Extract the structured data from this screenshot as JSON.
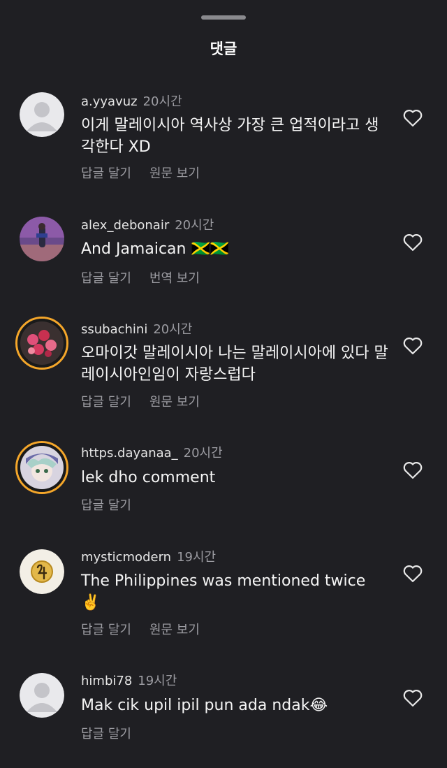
{
  "header": {
    "title": "댓글"
  },
  "comments": [
    {
      "user": "a.yyavuz",
      "time": "20시간",
      "text": "이게 말레이시아 역사상 가장 큰 업적이라고 생각한다 XD",
      "reply": "답글 달기",
      "extra": "원문 보기",
      "avatar": "default-avatar"
    },
    {
      "user": "alex_debonair",
      "time": "20시간",
      "text": "And Jamaican 🇯🇲🇯🇲",
      "reply": "답글 달기",
      "extra": "번역 보기",
      "avatar": "photo-avatar"
    },
    {
      "user": "ssubachini",
      "time": "20시간",
      "text": "오마이갓 말레이시아 나는 말레이시아에 있다 말레이시아인임이 자랑스럽다",
      "reply": "답글 달기",
      "extra": "원문 보기",
      "avatar": "roses-avatar"
    },
    {
      "user": "https.dayanaa_",
      "time": "20시간",
      "text": "lek dho comment",
      "reply": "답글 달기",
      "extra": "",
      "avatar": "anime-avatar"
    },
    {
      "user": "mysticmodern",
      "time": "19시간",
      "text": "The Philippines was mentioned twice ✌️",
      "reply": "답글 달기",
      "extra": "원문 보기",
      "avatar": "jupiter-symbol-avatar"
    },
    {
      "user": "himbi78",
      "time": "19시간",
      "text": "Mak cik upil ipil pun ada ndak😂",
      "reply": "답글 달기",
      "extra": "",
      "avatar": "default-avatar"
    }
  ],
  "icons": {
    "like": "heart-outline-icon"
  },
  "colors": {
    "background": "#1f1f23",
    "secondary_text": "#9c9ca2",
    "story_ring": "#f4a62a"
  }
}
